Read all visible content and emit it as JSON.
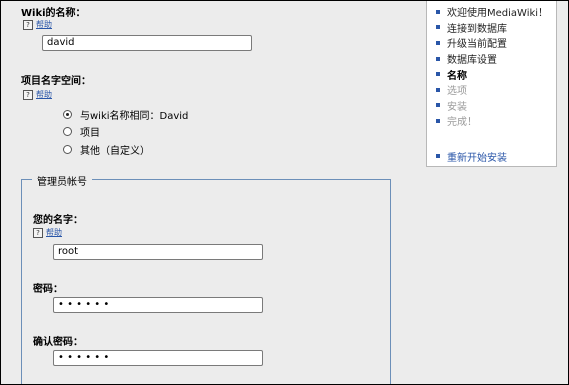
{
  "wiki_name": {
    "label": "Wiki的名称：",
    "help_label": "帮助",
    "value": "david"
  },
  "namespace": {
    "label": "项目名字空间：",
    "help_label": "帮助",
    "options": [
      {
        "label": "与wiki名称相同：David",
        "checked": true
      },
      {
        "label": "项目",
        "checked": false
      },
      {
        "label": "其他（自定义）",
        "checked": false
      }
    ]
  },
  "admin_account": {
    "legend": "管理员帐号",
    "username_label": "您的名字：",
    "help_label": "帮助",
    "username_value": "root",
    "password_label": "密码：",
    "password_value": "• • • • • •",
    "confirm_label": "确认密码：",
    "confirm_value": "• • • • • •"
  },
  "sidebar": {
    "steps": [
      {
        "label": "欢迎使用MediaWiki！",
        "state": "done"
      },
      {
        "label": "连接到数据库",
        "state": "done"
      },
      {
        "label": "升级当前配置",
        "state": "done"
      },
      {
        "label": "数据库设置",
        "state": "done"
      },
      {
        "label": "名称",
        "state": "current"
      },
      {
        "label": "选项",
        "state": "future"
      },
      {
        "label": "安装",
        "state": "future"
      },
      {
        "label": "完成！",
        "state": "future"
      }
    ],
    "restart_label": "重新开始安装"
  },
  "colors": {
    "link": "#2a56a8",
    "fieldset_border": "#6c8fb8",
    "background": "#ececec"
  }
}
